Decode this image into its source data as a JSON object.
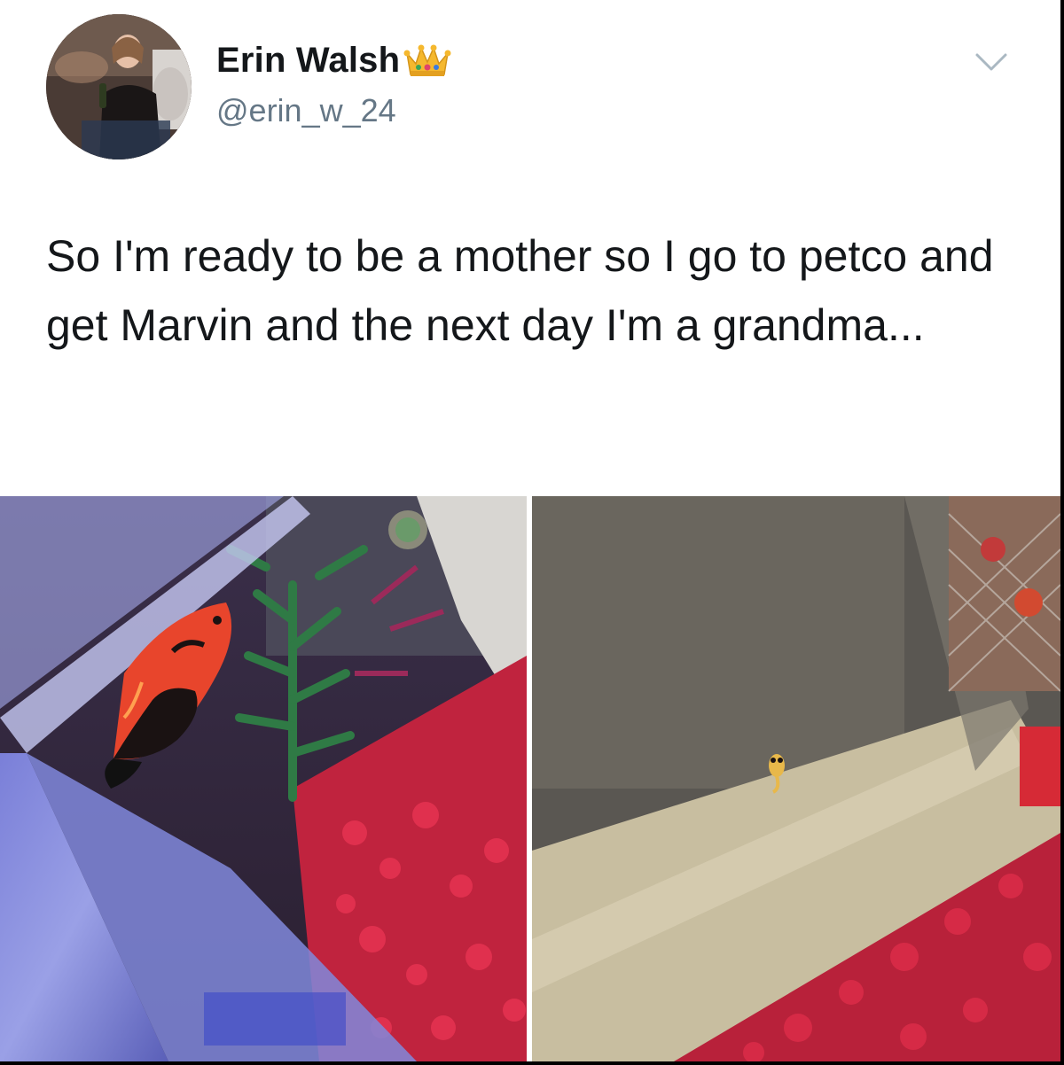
{
  "tweet": {
    "author": {
      "display_name": "Erin Walsh",
      "handle": "@erin_w_24",
      "name_emoji": "crown-emoji",
      "avatar": "profile-photo"
    },
    "menu_icon": "chevron-down-icon",
    "text": "So I'm ready to be a mother so I go to petco and get Marvin and the next day I'm a grandma...",
    "media": [
      {
        "name": "fish-tank-photo-adult-fish",
        "description_icon": "photo"
      },
      {
        "name": "fish-tank-photo-baby-fish",
        "description_icon": "photo"
      }
    ]
  },
  "colors": {
    "text_primary": "#14171a",
    "text_secondary": "#657786",
    "background": "#ffffff",
    "frame": "#000000"
  }
}
